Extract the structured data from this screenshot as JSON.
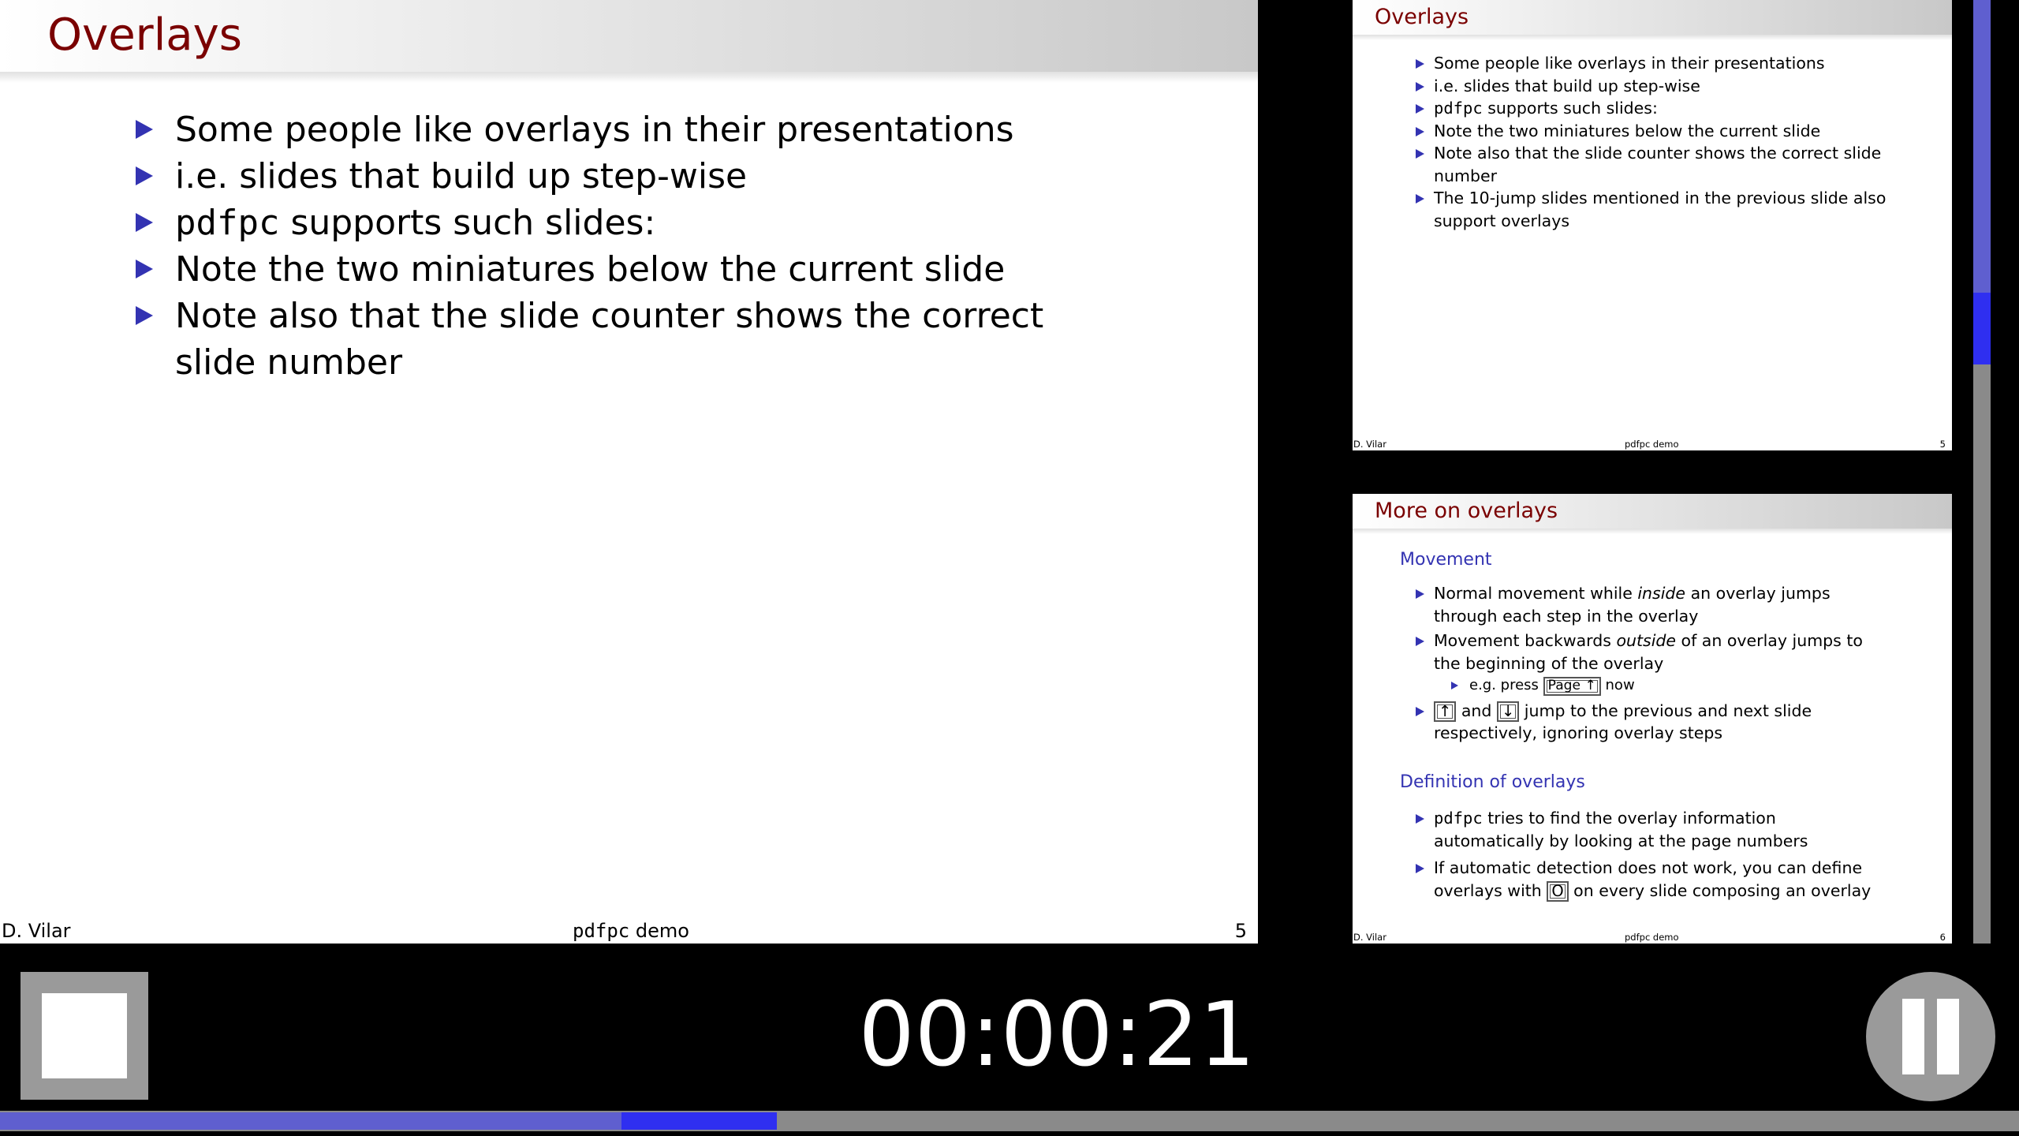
{
  "current_slide": {
    "title": "Overlays",
    "items": [
      {
        "mono": "",
        "text": "Some people like overlays in their presentations"
      },
      {
        "mono": "",
        "text": "i.e. slides that build up step-wise"
      },
      {
        "mono": "pdfpc",
        "text": " supports such slides:"
      },
      {
        "mono": "",
        "text": "Note the two miniatures below the current slide"
      },
      {
        "mono": "",
        "text": "Note also that the slide counter shows the correct slide number"
      }
    ],
    "footer": {
      "author": "D. Vilar",
      "title_mono": "pdfpc",
      "title_rest": " demo",
      "page": "5"
    }
  },
  "next_slide": {
    "title": "Overlays",
    "items": [
      {
        "mono": "",
        "text": "Some people like overlays in their presentations"
      },
      {
        "mono": "",
        "text": "i.e. slides that build up step-wise"
      },
      {
        "mono": "pdfpc",
        "text": " supports such slides:"
      },
      {
        "mono": "",
        "text": "Note the two miniatures below the current slide"
      },
      {
        "mono": "",
        "text": "Note also that the slide counter shows the correct slide number"
      },
      {
        "mono": "",
        "text": "The 10-jump slides mentioned in the previous slide also support overlays"
      }
    ],
    "footer": {
      "author": "D. Vilar",
      "title": "pdfpc demo",
      "page": "5"
    }
  },
  "next_next_slide": {
    "title": "More on overlays",
    "block1_title": "Movement",
    "b1_item1_a": "Normal movement while ",
    "b1_item1_em": "inside",
    "b1_item1_b": " an overlay jumps through each step in the overlay",
    "b1_item2_a": "Movement backwards ",
    "b1_item2_em": "outside",
    "b1_item2_b": " of an overlay jumps to the beginning of the overlay",
    "b1_sub_a": "e.g. press ",
    "b1_sub_key": "Page ↑",
    "b1_sub_b": " now",
    "b1_item3_key1": "↑",
    "b1_item3_mid": " and ",
    "b1_item3_key2": "↓",
    "b1_item3_b": " jump to the previous and next slide respectively, ignoring overlay steps",
    "block2_title": "Definition of overlays",
    "b2_item1_mono": "pdfpc",
    "b2_item1_b": " tries to find the overlay information automatically by looking at the page numbers",
    "b2_item2_a": "If automatic detection does not work, you can define overlays with ",
    "b2_item2_key": "O",
    "b2_item2_b": " on every slide composing an overlay",
    "footer": {
      "author": "D. Vilar",
      "title": "pdfpc demo",
      "page": "6"
    }
  },
  "timer": "00:00:21",
  "progress": {
    "done_fraction": 0.308,
    "current_fraction": 0.077
  },
  "slide_scrollbar": {
    "done_fraction": 0.31,
    "current_fraction": 0.076
  },
  "colors": {
    "title": "#7a0000",
    "bullet": "#3333b2",
    "progress_done": "#5f5fcf",
    "progress_current": "#2f2ff0"
  }
}
